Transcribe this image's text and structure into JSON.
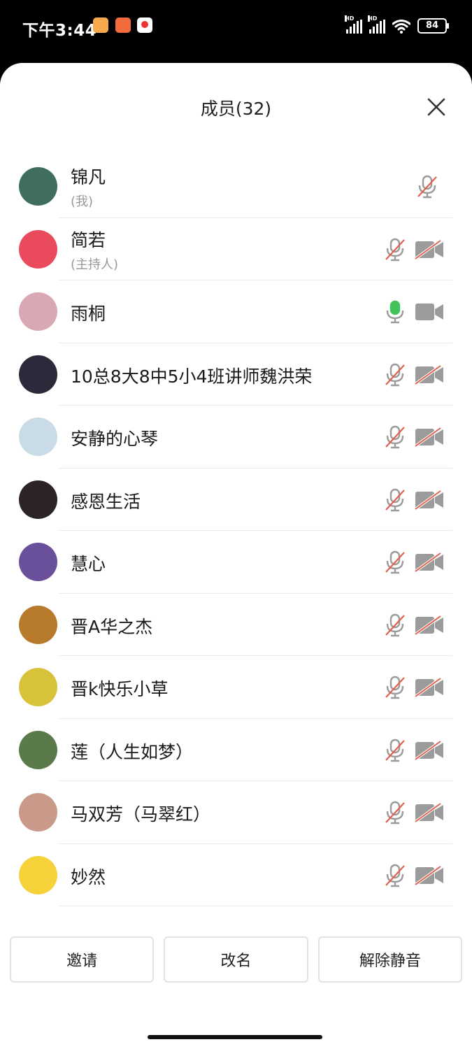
{
  "status_bar": {
    "time": "下午3:44",
    "battery": "84",
    "network_labels": [
      "HD",
      "HD"
    ],
    "icons": [
      "notes-app-icon",
      "taobao-app-icon",
      "map-app-icon",
      "signal-icon",
      "signal-icon",
      "wifi-icon",
      "battery-icon"
    ]
  },
  "header": {
    "title": "成员(32)",
    "close_icon": "close-icon"
  },
  "members": [
    {
      "name": "锦凡",
      "sub": "(我)",
      "mic": "muted",
      "cam": "none",
      "avatar_color": "#3f6f5c"
    },
    {
      "name": "简若",
      "sub": "(主持人)",
      "mic": "muted",
      "cam": "off",
      "avatar_color": "#e94b5c"
    },
    {
      "name": "雨桐",
      "sub": "",
      "mic": "active",
      "cam": "on",
      "avatar_color": "#d9a9b3"
    },
    {
      "name": "10总8大8中5小4班讲师魏洪荣",
      "sub": "",
      "mic": "muted",
      "cam": "off",
      "avatar_color": "#2a2a3a"
    },
    {
      "name": "安静的心琴",
      "sub": "",
      "mic": "muted",
      "cam": "off",
      "avatar_color": "#c9dbe6"
    },
    {
      "name": "感恩生活",
      "sub": "",
      "mic": "muted",
      "cam": "off",
      "avatar_color": "#2c2424"
    },
    {
      "name": "慧心",
      "sub": "",
      "mic": "muted",
      "cam": "off",
      "avatar_color": "#6a4f9a"
    },
    {
      "name": "晋A华之杰",
      "sub": "",
      "mic": "muted",
      "cam": "off",
      "avatar_color": "#b87a2c"
    },
    {
      "name": "晋k快乐小草",
      "sub": "",
      "mic": "muted",
      "cam": "off",
      "avatar_color": "#d8c23a"
    },
    {
      "name": "莲（人生如梦）",
      "sub": "",
      "mic": "muted",
      "cam": "off",
      "avatar_color": "#5a7a4a"
    },
    {
      "name": "马双芳（马翠红）",
      "sub": "",
      "mic": "muted",
      "cam": "off",
      "avatar_color": "#c99a8a"
    },
    {
      "name": "妙然",
      "sub": "",
      "mic": "muted",
      "cam": "off",
      "avatar_color": "#f5d23a"
    }
  ],
  "buttons": {
    "invite": "邀请",
    "rename": "改名",
    "unmute": "解除静音"
  },
  "colors": {
    "mic_active": "#41c35a",
    "icon_gray": "#9b9b9b",
    "mute_slash": "#e0614f"
  }
}
